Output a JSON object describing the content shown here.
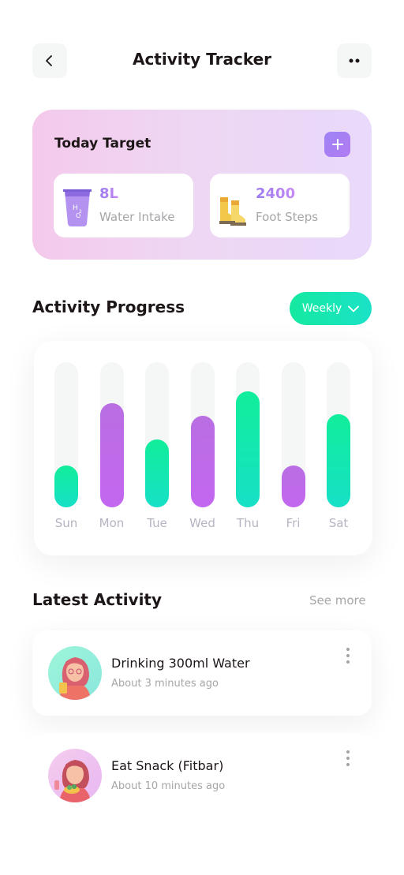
{
  "header": {
    "title": "Activity Tracker"
  },
  "today_target": {
    "title": "Today Target",
    "items": [
      {
        "value": "8L",
        "label": "Water Intake",
        "icon": "water-glass-icon"
      },
      {
        "value": "2400",
        "label": "Foot Steps",
        "icon": "boots-icon"
      }
    ]
  },
  "activity_progress": {
    "title": "Activity Progress",
    "period": "Weekly"
  },
  "chart_data": {
    "type": "bar",
    "categories": [
      "Sun",
      "Mon",
      "Tue",
      "Wed",
      "Thu",
      "Fri",
      "Sat"
    ],
    "values": [
      0.29,
      0.72,
      0.47,
      0.63,
      0.8,
      0.29,
      0.64
    ],
    "colors": [
      "green",
      "purple",
      "green",
      "purple",
      "green",
      "purple",
      "green"
    ],
    "ylim": [
      0,
      1
    ]
  },
  "latest_activity": {
    "title": "Latest Activity",
    "see_more": "See more",
    "items": [
      {
        "title": "Drinking 300ml Water",
        "time": "About 3 minutes ago"
      },
      {
        "title": "Eat Snack (Fitbar)",
        "time": "About 10 minutes ago"
      }
    ]
  },
  "colors": {
    "accent_green": "#14E9A0",
    "accent_purple": "#C367F0",
    "text_dark": "#1D1617",
    "text_gray": "#A7A5A8"
  }
}
